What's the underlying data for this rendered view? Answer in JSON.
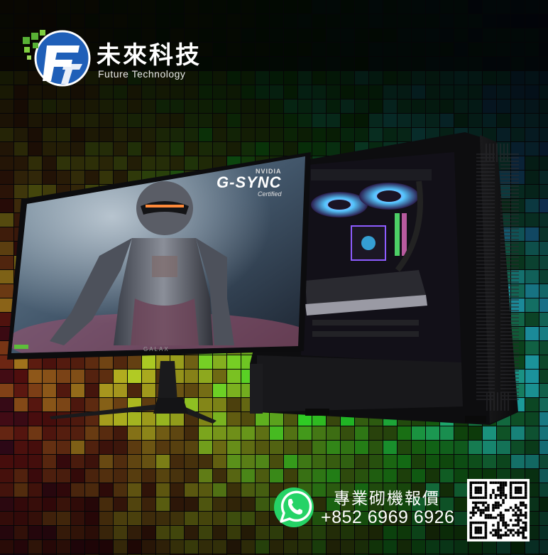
{
  "logo": {
    "title": "未來科技",
    "subtitle": "Future Technology",
    "icon": "ft-globe-logo-icon"
  },
  "monitor": {
    "badge_brand": "NVIDIA",
    "badge_name": "G-SYNC",
    "badge_sub": "Certified",
    "brand": "GALAX"
  },
  "contact": {
    "label": "專業砌機報價",
    "phone": "+852 6969 6926",
    "icon": "whatsapp-icon"
  },
  "colors": {
    "background": "#050507",
    "logo_blue": "#1f5fb8",
    "logo_green": "#58b135",
    "whatsapp_green": "#25d366"
  }
}
